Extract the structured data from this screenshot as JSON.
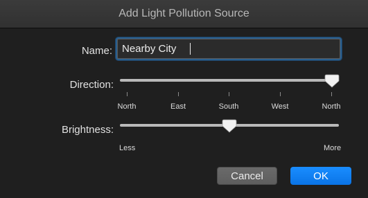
{
  "dialog": {
    "title": "Add Light Pollution Source"
  },
  "name": {
    "label": "Name:",
    "value": "Nearby City"
  },
  "direction": {
    "label": "Direction:",
    "value": "North",
    "ticks": [
      "North",
      "East",
      "South",
      "West",
      "North"
    ]
  },
  "brightness": {
    "label": "Brightness:",
    "min_label": "Less",
    "max_label": "More",
    "value_fraction": 0.5
  },
  "buttons": {
    "cancel": "Cancel",
    "ok": "OK"
  },
  "colors": {
    "accent": "#0a74e6",
    "focus_ring": "#2a5f8e"
  }
}
